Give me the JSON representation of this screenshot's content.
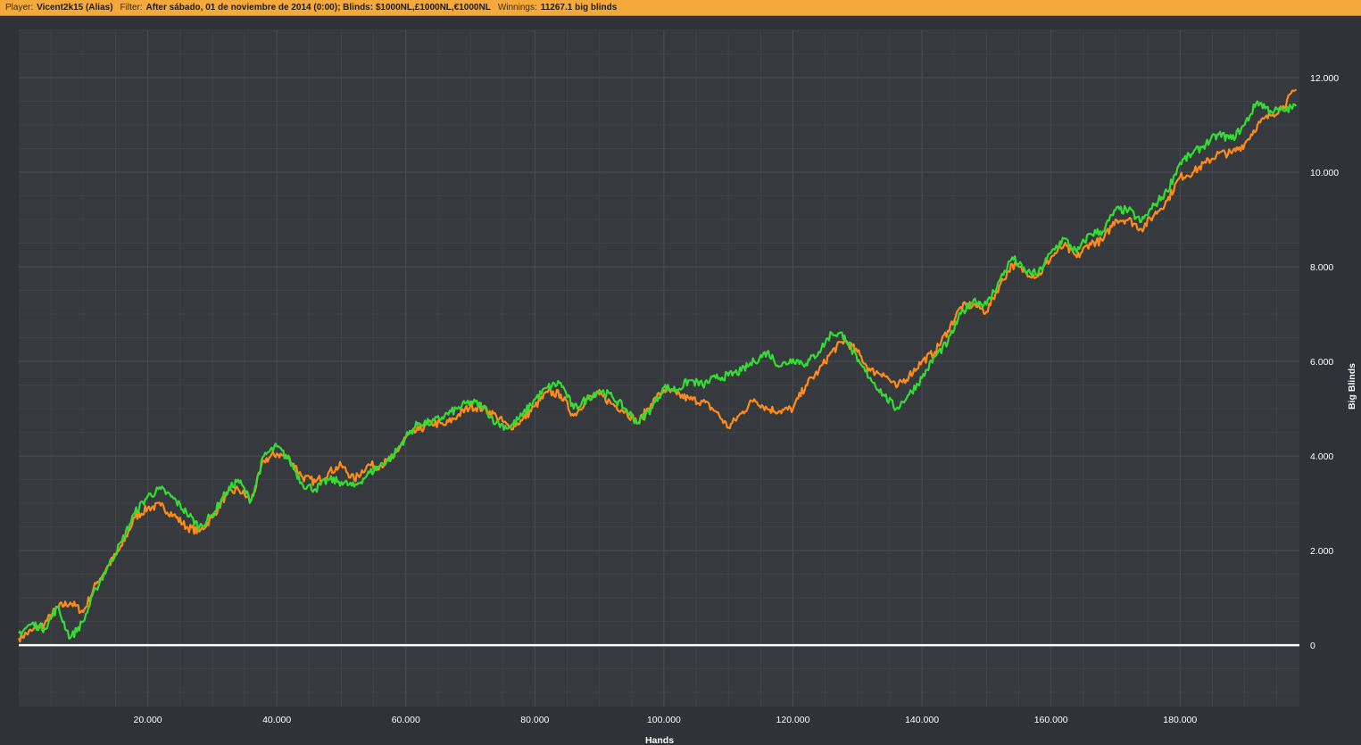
{
  "header": {
    "player_label": "Player:",
    "player_value": "Vicent2k15 (Alias)",
    "filter_label": "Filter:",
    "filter_value": "After sábado, 01 de noviembre de 2014 (0:00); Blinds: $1000NL,£1000NL,€1000NL",
    "winnings_label": "Winnings:",
    "winnings_value": "11267.1 big blinds"
  },
  "colors": {
    "background": "#2f3337",
    "plot_background": "#36393d",
    "grid": "#4a4e52",
    "header": "#f4a93a",
    "zero_line": "#ffffff"
  },
  "chart_data": {
    "type": "line",
    "title": "",
    "xlabel": "Hands",
    "ylabel": "Big Blinds",
    "xlim": [
      0,
      198500
    ],
    "ylim": [
      -1300,
      13000
    ],
    "x_ticks": [
      20000,
      40000,
      60000,
      80000,
      100000,
      120000,
      140000,
      160000,
      180000
    ],
    "x_tick_labels": [
      "20.000",
      "40.000",
      "60.000",
      "80.000",
      "100.000",
      "120.000",
      "140.000",
      "160.000",
      "180.000"
    ],
    "y_ticks": [
      0,
      2000,
      4000,
      6000,
      8000,
      10000,
      12000
    ],
    "y_tick_labels": [
      "0",
      "2.000",
      "4.000",
      "6.000",
      "8.000",
      "10.000",
      "12.000"
    ],
    "grid": true,
    "legend": "none",
    "series": [
      {
        "color": "#ff8c1a",
        "x": [
          0,
          2000,
          4000,
          6000,
          8000,
          10000,
          12000,
          14000,
          16000,
          18000,
          20000,
          22000,
          24000,
          26000,
          28000,
          30000,
          32000,
          34000,
          36000,
          38000,
          40000,
          42000,
          44000,
          46000,
          48000,
          50000,
          52000,
          54000,
          56000,
          58000,
          60000,
          62000,
          64000,
          66000,
          68000,
          70000,
          72000,
          74000,
          76000,
          78000,
          80000,
          82000,
          84000,
          86000,
          88000,
          90000,
          92000,
          94000,
          96000,
          98000,
          100000,
          102000,
          104000,
          106000,
          108000,
          110000,
          112000,
          114000,
          116000,
          118000,
          120000,
          122000,
          124000,
          126000,
          128000,
          130000,
          132000,
          134000,
          136000,
          138000,
          140000,
          142000,
          144000,
          146000,
          148000,
          150000,
          152000,
          154000,
          156000,
          158000,
          160000,
          162000,
          164000,
          166000,
          168000,
          170000,
          172000,
          174000,
          176000,
          178000,
          180000,
          182000,
          184000,
          186000,
          188000,
          190000,
          192000,
          194000,
          196000,
          198000
        ],
        "y": [
          150,
          300,
          450,
          800,
          900,
          700,
          1300,
          1700,
          2100,
          2700,
          2900,
          2950,
          2750,
          2500,
          2400,
          2700,
          3150,
          3300,
          3050,
          3900,
          4050,
          3950,
          3550,
          3450,
          3650,
          3800,
          3500,
          3800,
          3800,
          3950,
          4400,
          4550,
          4700,
          4650,
          4850,
          5050,
          5000,
          4850,
          4600,
          4750,
          5050,
          5350,
          5300,
          4850,
          5200,
          5300,
          5100,
          4950,
          4700,
          5100,
          5400,
          5300,
          5200,
          5150,
          4950,
          4600,
          4900,
          5200,
          5000,
          4950,
          5000,
          5500,
          5800,
          6200,
          6450,
          6200,
          5800,
          5750,
          5450,
          5700,
          6000,
          6200,
          6650,
          7150,
          7200,
          7050,
          7600,
          8050,
          7900,
          7800,
          8200,
          8450,
          8200,
          8500,
          8550,
          9000,
          9000,
          8800,
          9100,
          9400,
          9900,
          10000,
          10200,
          10400,
          10400,
          10600,
          11000,
          11200,
          11400,
          11750
        ]
      },
      {
        "color": "#33dd33",
        "x": [
          0,
          2000,
          4000,
          6000,
          8000,
          10000,
          12000,
          14000,
          16000,
          18000,
          20000,
          22000,
          24000,
          26000,
          28000,
          30000,
          32000,
          34000,
          36000,
          38000,
          40000,
          42000,
          44000,
          46000,
          48000,
          50000,
          52000,
          54000,
          56000,
          58000,
          60000,
          62000,
          64000,
          66000,
          68000,
          70000,
          72000,
          74000,
          76000,
          78000,
          80000,
          82000,
          84000,
          86000,
          88000,
          90000,
          92000,
          94000,
          96000,
          98000,
          100000,
          102000,
          104000,
          106000,
          108000,
          110000,
          112000,
          114000,
          116000,
          118000,
          120000,
          122000,
          124000,
          126000,
          128000,
          130000,
          132000,
          134000,
          136000,
          138000,
          140000,
          142000,
          144000,
          146000,
          148000,
          150000,
          152000,
          154000,
          156000,
          158000,
          160000,
          162000,
          164000,
          166000,
          168000,
          170000,
          172000,
          174000,
          176000,
          178000,
          180000,
          182000,
          184000,
          186000,
          188000,
          190000,
          192000,
          194000,
          196000,
          198000
        ],
        "y": [
          250,
          450,
          350,
          800,
          150,
          500,
          1200,
          1700,
          2200,
          2800,
          3150,
          3300,
          3100,
          2800,
          2500,
          2750,
          3200,
          3500,
          3050,
          4000,
          4200,
          3900,
          3400,
          3300,
          3500,
          3450,
          3350,
          3600,
          3800,
          4000,
          4400,
          4700,
          4700,
          4850,
          5000,
          5150,
          5050,
          4700,
          4600,
          4850,
          5200,
          5450,
          5550,
          5000,
          5200,
          5400,
          5250,
          5000,
          4700,
          5000,
          5450,
          5400,
          5600,
          5500,
          5650,
          5700,
          5800,
          6000,
          6200,
          5900,
          6050,
          5950,
          6200,
          6600,
          6550,
          6000,
          5650,
          5300,
          5000,
          5300,
          5650,
          6100,
          6400,
          7000,
          7300,
          7200,
          7700,
          8200,
          7900,
          7850,
          8300,
          8600,
          8300,
          8700,
          8750,
          9200,
          9200,
          8950,
          9300,
          9600,
          10200,
          10400,
          10600,
          10800,
          10700,
          11000,
          11500,
          11300,
          11300,
          11400
        ]
      }
    ]
  }
}
